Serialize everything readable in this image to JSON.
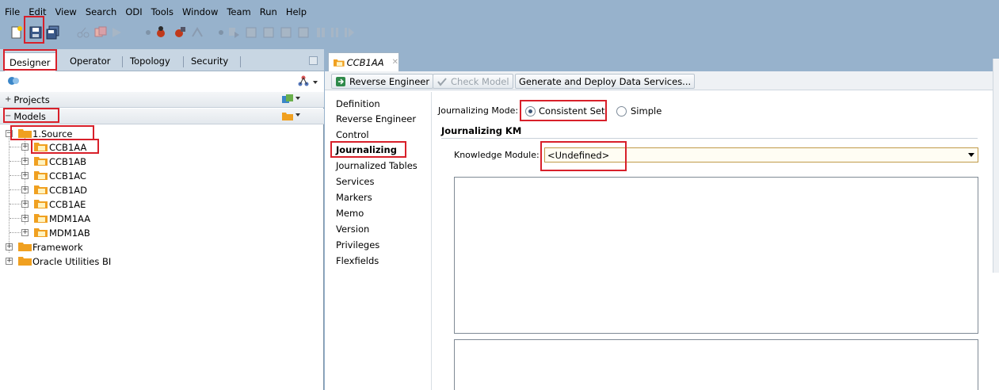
{
  "menu": [
    "File",
    "Edit",
    "View",
    "Search",
    "ODI",
    "Tools",
    "Window",
    "Team",
    "Run",
    "Help"
  ],
  "left_tabs": [
    "Designer",
    "Operator",
    "Topology",
    "Security"
  ],
  "accordion": {
    "projects": "Projects",
    "models": "Models"
  },
  "tree": {
    "source": "1.Source",
    "models": [
      "CCB1AA",
      "CCB1AB",
      "CCB1AC",
      "CCB1AD",
      "CCB1AE",
      "MDM1AA",
      "MDM1AB"
    ],
    "framework": "Framework",
    "oracle_bi": "Oracle Utilities BI"
  },
  "doc_tab": {
    "title": "CCB1AA"
  },
  "doc_toolbar": {
    "reverse_engineer": "Reverse Engineer",
    "check_model": "Check Model",
    "generate_deploy": "Generate and Deploy Data Services..."
  },
  "side_nav": [
    "Definition",
    "Reverse Engineer",
    "Control",
    "Journalizing",
    "Journalized Tables",
    "Services",
    "Markers",
    "Memo",
    "Version",
    "Privileges",
    "Flexfields"
  ],
  "journalizing": {
    "mode_label": "Journalizing Mode:",
    "option_consistent": "Consistent Set",
    "option_simple": "Simple",
    "selected_mode": "Consistent Set",
    "km_section": "Journalizing KM",
    "km_label": "Knowledge Module:",
    "km_value": "<Undefined>"
  },
  "colors": {
    "highlight": "#d8202a",
    "chrome": "#97b2cc",
    "folder": "#f0a020"
  }
}
